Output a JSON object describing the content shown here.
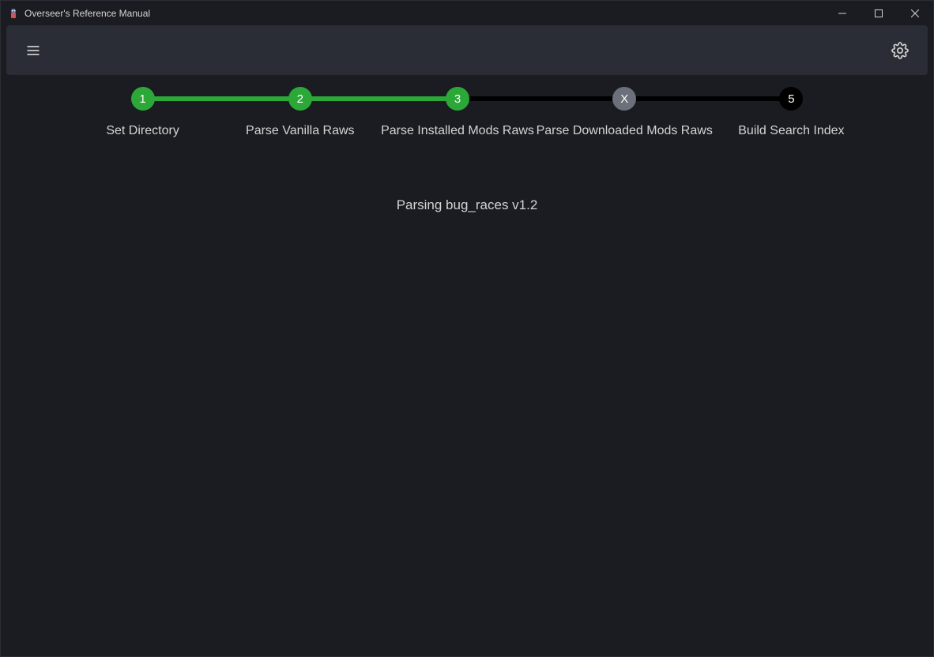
{
  "window": {
    "title": "Overseer's Reference Manual"
  },
  "stepper": {
    "steps": [
      {
        "number": "1",
        "label": "Set Directory",
        "status": "complete"
      },
      {
        "number": "2",
        "label": "Parse Vanilla Raws",
        "status": "complete"
      },
      {
        "number": "3",
        "label": "Parse Installed Mods Raws",
        "status": "complete"
      },
      {
        "number": "X",
        "label": "Parse Downloaded Mods Raws",
        "status": "skipped"
      },
      {
        "number": "5",
        "label": "Build Search Index",
        "status": "pending"
      }
    ]
  },
  "status": {
    "message": "Parsing bug_races v1.2"
  },
  "colors": {
    "complete": "#2ba838",
    "skipped": "#6b707a",
    "pending": "#000000",
    "background": "#1a1c21",
    "toolbar": "#2a2d35",
    "text": "#d4d4d4"
  }
}
